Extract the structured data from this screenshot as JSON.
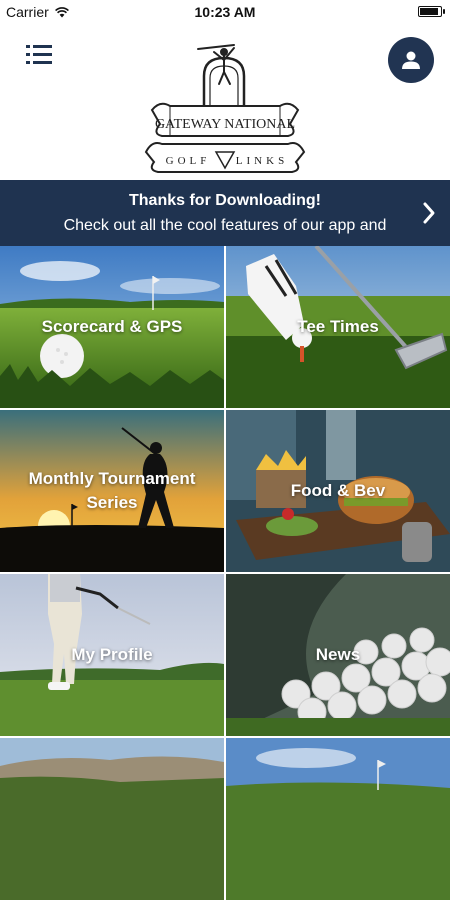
{
  "status_bar": {
    "carrier": "Carrier",
    "time": "10:23 AM"
  },
  "header": {
    "menu_icon": "hamburger-menu-icon",
    "profile_icon": "user-icon",
    "logo": {
      "line1": "GATEWAY NATIONAL",
      "line2_left": "GOLF",
      "line2_right": "LINKS"
    }
  },
  "banner": {
    "title": "Thanks for Downloading!",
    "subtitle": "Check out all the cool features of our app and",
    "chevron_icon": "chevron-right-icon"
  },
  "tiles": [
    {
      "label": "Scorecard & GPS"
    },
    {
      "label": "Tee Times"
    },
    {
      "label": "Monthly Tournament Series"
    },
    {
      "label": "Food & Bev"
    },
    {
      "label": "My Profile"
    },
    {
      "label": "News"
    },
    {
      "label": ""
    },
    {
      "label": ""
    }
  ],
  "colors": {
    "navy": "#1f3350",
    "profile_bg": "#213452"
  }
}
